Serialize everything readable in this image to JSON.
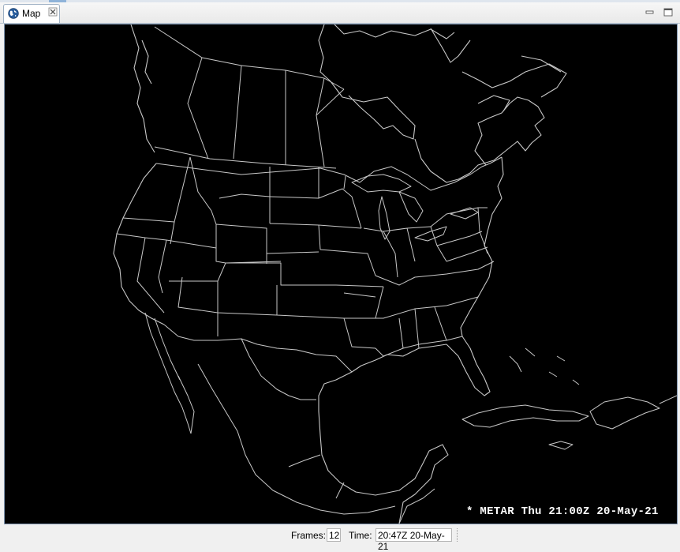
{
  "tab": {
    "label": "Map",
    "icon": "globe-icon"
  },
  "window_controls": [
    "minimize-icon",
    "maximize-icon"
  ],
  "map": {
    "background": "#000000",
    "outline_color": "#c8c8c8",
    "overlay": {
      "star": "*",
      "text": "METAR Thu 21:00Z 20-May-21"
    }
  },
  "status": {
    "frames_label": "Frames:",
    "frames_value": "12",
    "time_label": "Time:",
    "time_value": "20:47Z 20-May-21"
  }
}
